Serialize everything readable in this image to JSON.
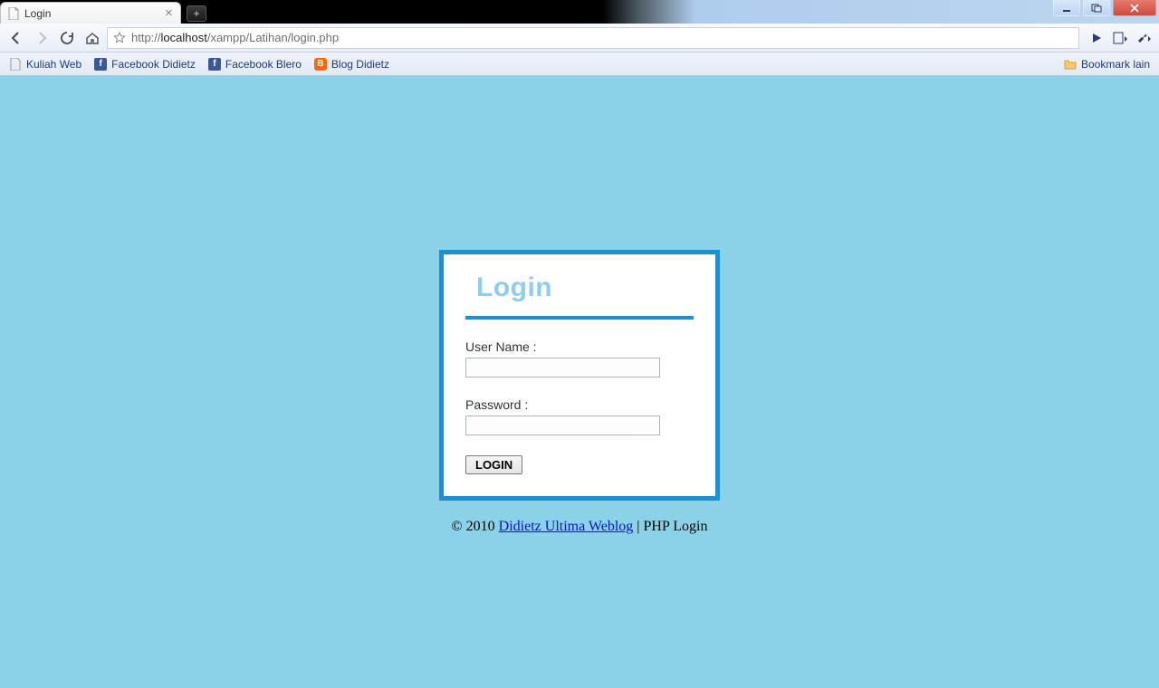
{
  "browser": {
    "tab_title": "Login",
    "url_pre": "http://",
    "url_host": "localhost",
    "url_path": "/xampp/Latihan/login.php"
  },
  "bookmarks": {
    "items": [
      {
        "label": "Kuliah Web"
      },
      {
        "label": "Facebook Didietz"
      },
      {
        "label": "Facebook Blero"
      },
      {
        "label": "Blog Didietz"
      }
    ],
    "right_label": "Bookmark lain"
  },
  "login": {
    "heading": "Login",
    "username_label": "User Name :",
    "username_value": "",
    "password_label": "Password :",
    "password_value": "",
    "submit_label": "LOGIN"
  },
  "footer": {
    "copyright_prefix": "© 2010 ",
    "link_text": "Didietz Ultima Weblog",
    "suffix": " | PHP Login"
  },
  "colors": {
    "page_bg": "#8bd1e8",
    "box_border": "#1a91d3",
    "heading": "#8fcdee"
  }
}
